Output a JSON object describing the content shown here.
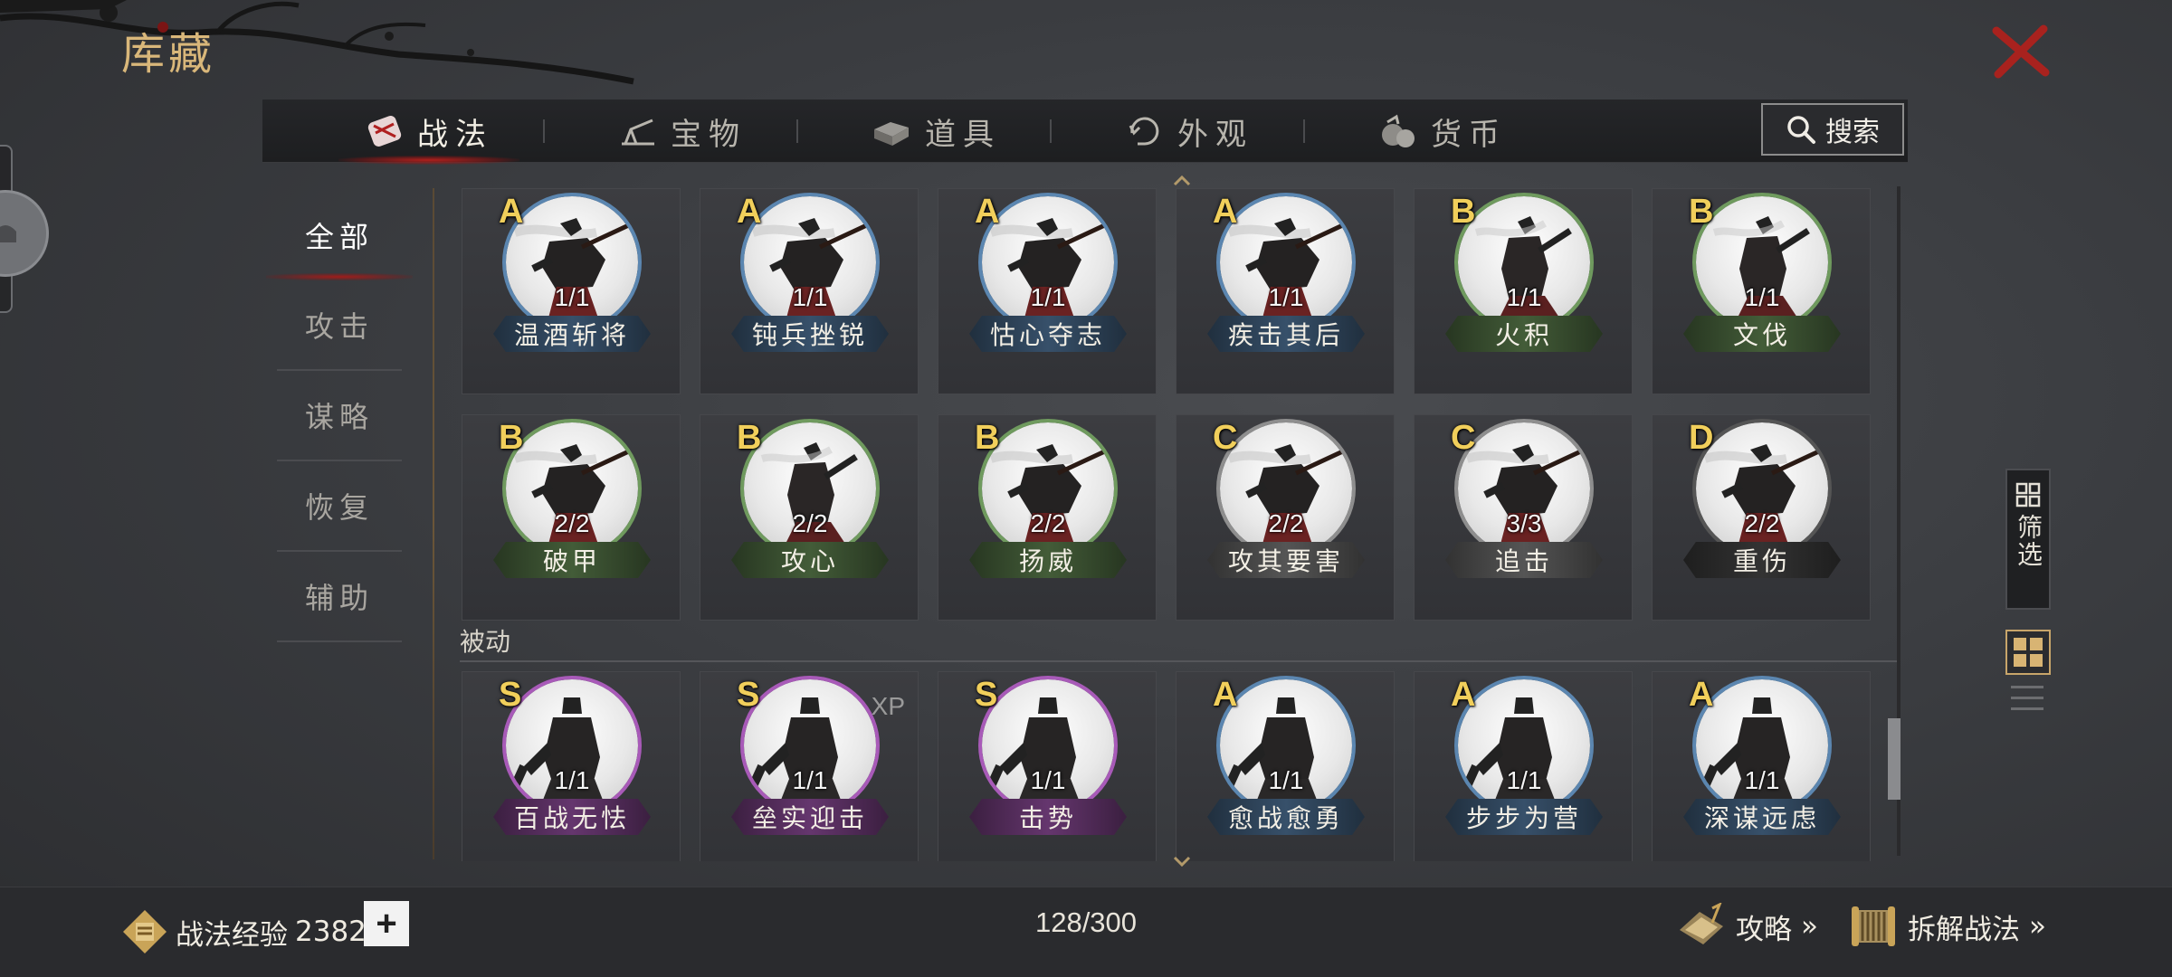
{
  "header": {
    "title": "库藏",
    "close_icon": "close-icon"
  },
  "tabs": [
    {
      "label": "战法",
      "icon": "tactics-icon",
      "active": true
    },
    {
      "label": "宝物",
      "icon": "treasure-icon",
      "active": false
    },
    {
      "label": "道具",
      "icon": "items-icon",
      "active": false
    },
    {
      "label": "外观",
      "icon": "appearance-icon",
      "active": false
    },
    {
      "label": "货币",
      "icon": "currency-icon",
      "active": false
    }
  ],
  "search": {
    "label": "搜索",
    "icon": "search-icon"
  },
  "categories": [
    {
      "label": "全部",
      "active": true
    },
    {
      "label": "攻击",
      "active": false
    },
    {
      "label": "谋略",
      "active": false
    },
    {
      "label": "恢复",
      "active": false
    },
    {
      "label": "辅助",
      "active": false
    }
  ],
  "section_label": "被动",
  "cards": [
    {
      "grade": "A",
      "count": "1/1",
      "name": "温酒斩将",
      "color": "#5b86b0",
      "pose": "rider"
    },
    {
      "grade": "A",
      "count": "1/1",
      "name": "钝兵挫锐",
      "color": "#5b86b0",
      "pose": "rider"
    },
    {
      "grade": "A",
      "count": "1/1",
      "name": "怙心夺志",
      "color": "#5b86b0",
      "pose": "rider"
    },
    {
      "grade": "A",
      "count": "1/1",
      "name": "疾击其后",
      "color": "#5b86b0",
      "pose": "rider"
    },
    {
      "grade": "B",
      "count": "1/1",
      "name": "火积",
      "color": "#6f9a5e",
      "pose": "scholar"
    },
    {
      "grade": "B",
      "count": "1/1",
      "name": "文伐",
      "color": "#6f9a5e",
      "pose": "scholar"
    },
    {
      "grade": "B",
      "count": "2/2",
      "name": "破甲",
      "color": "#6f9a5e",
      "pose": "rider"
    },
    {
      "grade": "B",
      "count": "2/2",
      "name": "攻心",
      "color": "#6f9a5e",
      "pose": "scholar"
    },
    {
      "grade": "B",
      "count": "2/2",
      "name": "扬威",
      "color": "#6f9a5e",
      "pose": "rider"
    },
    {
      "grade": "C",
      "count": "2/2",
      "name": "攻其要害",
      "color": "#8e8e8e",
      "pose": "rider"
    },
    {
      "grade": "C",
      "count": "3/3",
      "name": "追击",
      "color": "#8e8e8e",
      "pose": "rider"
    },
    {
      "grade": "D",
      "count": "2/2",
      "name": "重伤",
      "color": "#555555",
      "pose": "rider"
    },
    {
      "grade": "S",
      "count": "1/1",
      "name": "百战无怯",
      "color": "#a85ab8",
      "pose": "guard"
    },
    {
      "grade": "S",
      "count": "1/1",
      "name": "垒实迎击",
      "color": "#a85ab8",
      "pose": "guard",
      "xp": "XP"
    },
    {
      "grade": "S",
      "count": "1/1",
      "name": "击势",
      "color": "#a85ab8",
      "pose": "guard"
    },
    {
      "grade": "A",
      "count": "1/1",
      "name": "愈战愈勇",
      "color": "#5b86b0",
      "pose": "guard"
    },
    {
      "grade": "A",
      "count": "1/1",
      "name": "步步为营",
      "color": "#5b86b0",
      "pose": "guard"
    },
    {
      "grade": "A",
      "count": "1/1",
      "name": "深谋远虑",
      "color": "#5b86b0",
      "pose": "guard"
    }
  ],
  "side_tools": {
    "filter_label": "筛选",
    "filter_icon": "filter-icon",
    "grid_view_icon": "grid-view-icon",
    "list_view_icon": "list-view-icon"
  },
  "footer": {
    "exp_label": "战法经验",
    "exp_value": "2382",
    "exp_icon": "fist-seal-icon",
    "plus": "+",
    "capacity": "128/300",
    "guide_label": "攻略",
    "guide_icon": "book-icon",
    "disassemble_label": "拆解战法",
    "disassemble_icon": "scroll-icon",
    "arrows": "»"
  }
}
